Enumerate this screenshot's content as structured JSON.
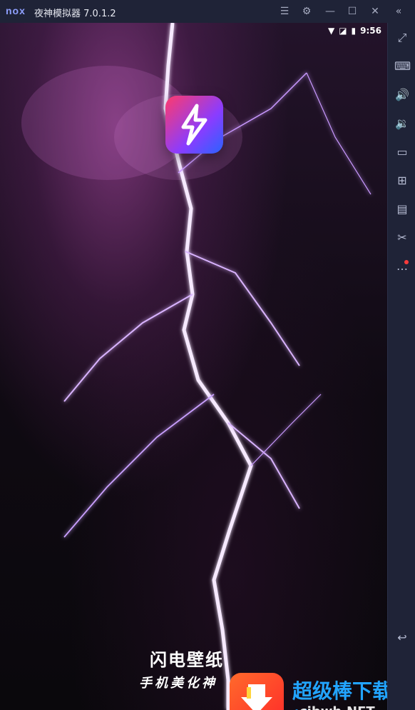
{
  "window": {
    "logo": "nox",
    "title": "夜神模拟器 7.0.1.2",
    "controls": {
      "menu_icon": "menu-icon",
      "settings_icon": "gear-icon",
      "minimize_icon": "minimize-icon",
      "maximize_icon": "maximize-icon",
      "close_icon": "close-icon",
      "collapse_icon": "collapse-sidebar-icon"
    }
  },
  "android": {
    "status": {
      "time": "9:56"
    }
  },
  "splash": {
    "title": "闪电壁纸",
    "subtitle": "手机美化神"
  },
  "sidebar": {
    "items": [
      {
        "name": "fullscreen"
      },
      {
        "name": "keyboard"
      },
      {
        "name": "volume-up"
      },
      {
        "name": "volume-down"
      },
      {
        "name": "screen"
      },
      {
        "name": "apk-install"
      },
      {
        "name": "multi-instance"
      },
      {
        "name": "screenshot"
      },
      {
        "name": "more"
      },
      {
        "name": "back"
      }
    ]
  },
  "watermark": {
    "title": "超级棒下载站",
    "subtitle": "cjbwh.NET"
  },
  "colors": {
    "titlebar": "#1f2337",
    "accent": "#22a4ff",
    "lightning": "#f4d7ff"
  }
}
